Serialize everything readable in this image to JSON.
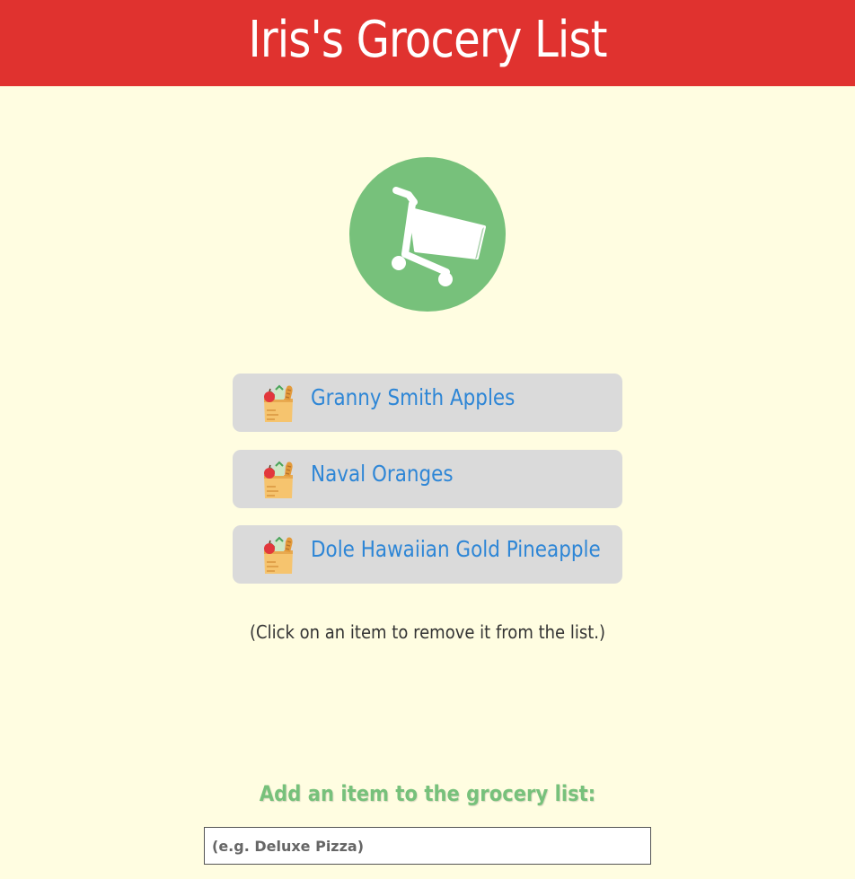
{
  "header": {
    "title": "Iris's Grocery List",
    "background": "#e0322f"
  },
  "logo": {
    "icon": "shopping-cart-icon",
    "circle_color": "#77c17b"
  },
  "items": [
    {
      "label": "Granny Smith Apples",
      "icon": "grocery-bag-icon"
    },
    {
      "label": "Naval Oranges",
      "icon": "grocery-bag-icon"
    },
    {
      "label": "Dole Hawaiian Gold Pineapple",
      "icon": "grocery-bag-icon"
    }
  ],
  "hint": "(Click on an item to remove it from the list.)",
  "add_form": {
    "title": "Add an item to the grocery list:",
    "placeholder": "(e.g. Deluxe Pizza)",
    "value": ""
  },
  "colors": {
    "page_background": "#fffde1",
    "item_background": "#dadada",
    "item_text": "#2e86d6",
    "accent_green": "#77c17b"
  }
}
